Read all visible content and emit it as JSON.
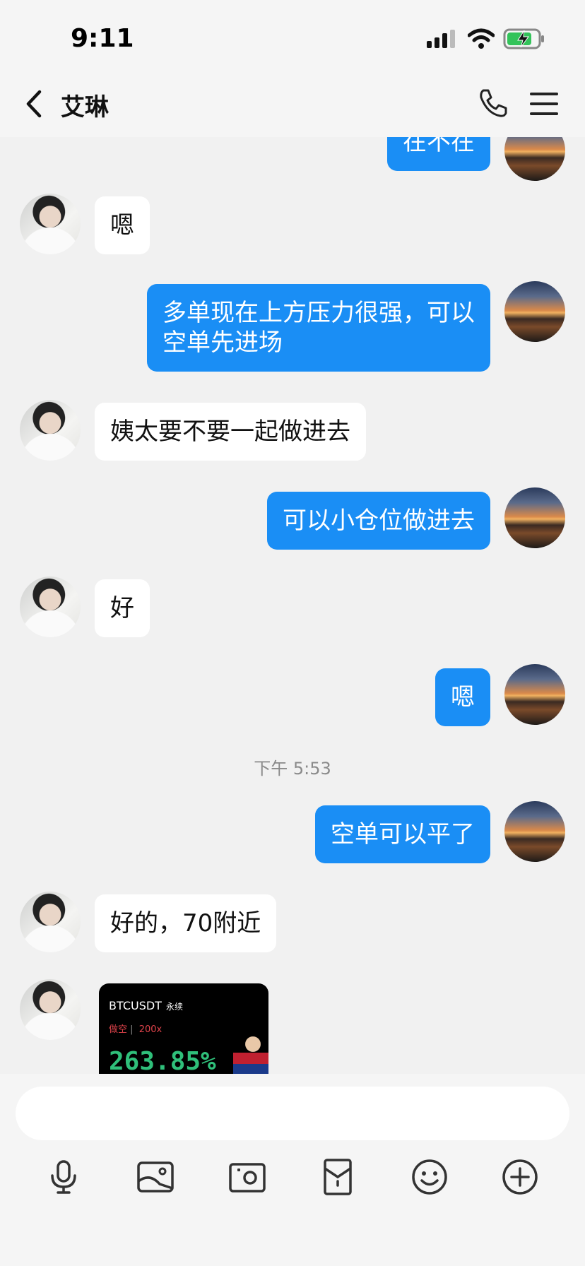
{
  "status": {
    "time": "9:11"
  },
  "header": {
    "title": "艾琳"
  },
  "messages": [
    {
      "side": "out",
      "text": "在不在"
    },
    {
      "side": "in",
      "text": "嗯"
    },
    {
      "side": "out",
      "text": "多单现在上方压力很强，可以空单先进场"
    },
    {
      "side": "in",
      "text": "姨太要不要一起做进去"
    },
    {
      "side": "out",
      "text": "可以小仓位做进去"
    },
    {
      "side": "in",
      "text": "好"
    },
    {
      "side": "out",
      "text": "嗯"
    },
    {
      "type": "time",
      "text": "下午 5:53"
    },
    {
      "side": "out",
      "text": "空单可以平了"
    },
    {
      "side": "in",
      "text": "好的，70附近"
    }
  ],
  "card": {
    "pair": "BTCUSDT",
    "contract": "永续",
    "side": "做空",
    "leverage": "200x",
    "roi": "263.85%",
    "roi_color": "#2fbf7a",
    "side_color": "#e0434b"
  },
  "colors": {
    "outgoing_bubble": "#1a8ef5",
    "incoming_bubble": "#ffffff",
    "background": "#f1f1f1"
  },
  "toolbar": [
    "mic-icon",
    "image-icon",
    "camera-icon",
    "red-packet-icon",
    "emoji-icon",
    "plus-icon"
  ]
}
